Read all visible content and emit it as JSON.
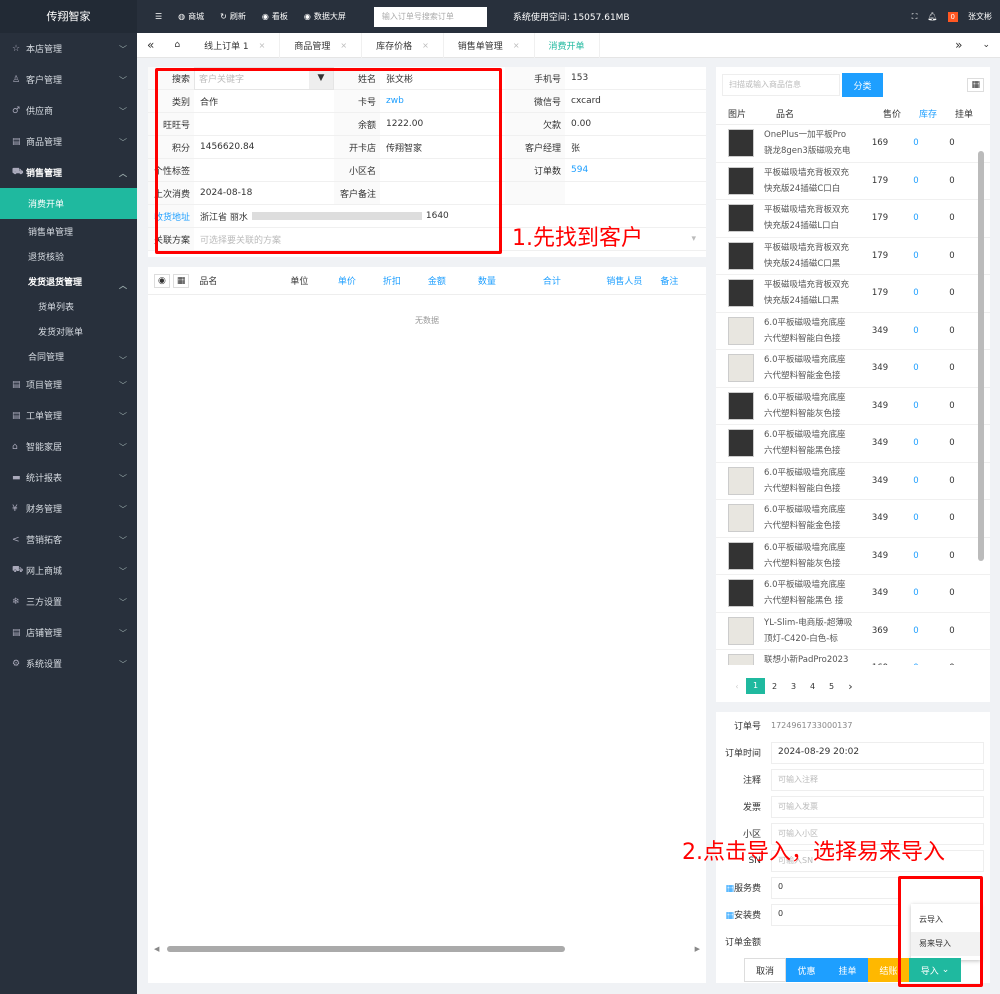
{
  "app": {
    "brand": "传翔智家"
  },
  "sidebar": {
    "items": [
      {
        "label": "本店管理",
        "icon": "☆"
      },
      {
        "label": "客户管理",
        "icon": "♙"
      },
      {
        "label": "供应商",
        "icon": "♂"
      },
      {
        "label": "商品管理",
        "icon": "▤"
      },
      {
        "label": "销售管理",
        "icon": "⛟"
      }
    ],
    "sales_sub": [
      "消费开单",
      "销售单管理",
      "退货核验",
      "发货退货管理"
    ],
    "ship_sub": [
      "货单列表",
      "发货对账单"
    ],
    "contract": "合同管理",
    "items2": [
      {
        "label": "项目管理",
        "icon": "▤"
      },
      {
        "label": "工单管理",
        "icon": "▤"
      },
      {
        "label": "智能家居",
        "icon": "⌂"
      },
      {
        "label": "统计报表",
        "icon": "▬"
      },
      {
        "label": "财务管理",
        "icon": "¥"
      },
      {
        "label": "营销拓客",
        "icon": "<"
      },
      {
        "label": "网上商城",
        "icon": "⛟"
      },
      {
        "label": "三方设置",
        "icon": "❄"
      },
      {
        "label": "店铺管理",
        "icon": "▤"
      },
      {
        "label": "系统设置",
        "icon": "⚙"
      }
    ]
  },
  "topbar": {
    "mall": "商城",
    "refresh": "刷新",
    "board": "看板",
    "bigscreen": "数据大屏",
    "search_placeholder": "输入订单号搜索订单",
    "space": "系统使用空间: 15057.61MB",
    "badge": "0",
    "user": "张文彬"
  },
  "tabs": [
    "线上订单 1",
    "商品管理",
    "库存价格",
    "销售单管理",
    "消费开单"
  ],
  "customer": {
    "search_label": "搜索",
    "search_placeholder": "客户关键字",
    "rows": [
      [
        "",
        "",
        "姓名",
        "张文彬",
        "手机号",
        "153"
      ],
      [
        "类别",
        "合作",
        "卡号",
        "zwb",
        "微信号",
        "cxcard"
      ],
      [
        "旺旺号",
        "",
        "余额",
        "1222.00",
        "欠款",
        "0.00"
      ],
      [
        "积分",
        "1456620.84",
        "开卡店",
        "传翔智家",
        "客户经理",
        "张"
      ],
      [
        "个性标签",
        "",
        "小区名",
        "",
        "订单数",
        "594"
      ],
      [
        "上次消费",
        "2024-08-18",
        "客户备注",
        "",
        "",
        ""
      ]
    ],
    "addr_label": "收货地址",
    "addr": "浙江省 丽水",
    "addr_tail": "1640",
    "plan_label": "关联方案",
    "plan_placeholder": "可选择要关联的方案"
  },
  "annotations": {
    "step1": "1.先找到客户",
    "step2": "2.点击导入，选择易来导入"
  },
  "order_table": {
    "headers": [
      "品名",
      "单位",
      "单价",
      "折扣",
      "金额",
      "数量",
      "合计",
      "销售人员",
      "备注"
    ],
    "empty": "无数据"
  },
  "products": {
    "search_placeholder": "扫描或输入商品信息",
    "category_btn": "分类",
    "headers": [
      "图片",
      "品名",
      "售价",
      "库存",
      "挂单"
    ],
    "rows": [
      {
        "name": "OnePlus一加平板Pro 骁龙8gen3版磁吸充电",
        "price": "169",
        "stock": "0",
        "hang": "0"
      },
      {
        "name": "平板磁吸墙充背板双充快充版24插磁C口白",
        "price": "179",
        "stock": "0",
        "hang": "0"
      },
      {
        "name": "平板磁吸墙充背板双充快充版24插磁L口白",
        "price": "179",
        "stock": "0",
        "hang": "0"
      },
      {
        "name": "平板磁吸墙充背板双充快充版24插磁C口黑",
        "price": "179",
        "stock": "0",
        "hang": "0"
      },
      {
        "name": "平板磁吸墙充背板双充快充版24插磁L口黑",
        "price": "179",
        "stock": "0",
        "hang": "0"
      },
      {
        "name": "6.0平板磁吸墙充底座 六代塑料智能白色接",
        "price": "349",
        "stock": "0",
        "hang": "0"
      },
      {
        "name": "6.0平板磁吸墙充底座 六代塑料智能金色接",
        "price": "349",
        "stock": "0",
        "hang": "0"
      },
      {
        "name": "6.0平板磁吸墙充底座 六代塑料智能灰色接",
        "price": "349",
        "stock": "0",
        "hang": "0"
      },
      {
        "name": "6.0平板磁吸墙充底座 六代塑料智能黑色接",
        "price": "349",
        "stock": "0",
        "hang": "0"
      },
      {
        "name": "6.0平板磁吸墙充底座 六代塑料智能白色接",
        "price": "349",
        "stock": "0",
        "hang": "0"
      },
      {
        "name": "6.0平板磁吸墙充底座 六代塑料智能金色接",
        "price": "349",
        "stock": "0",
        "hang": "0"
      },
      {
        "name": "6.0平板磁吸墙充底座 六代塑料智能灰色接",
        "price": "349",
        "stock": "0",
        "hang": "0"
      },
      {
        "name": "6.0平板磁吸墙充底座 六代塑料智能黑色 接",
        "price": "349",
        "stock": "0",
        "hang": "0"
      },
      {
        "name": "YL-Slim-电商版-超薄吸顶灯-C420-白色-标",
        "price": "369",
        "stock": "0",
        "hang": "0"
      },
      {
        "name": "联想小新PadPro2023",
        "price": "169",
        "stock": "0",
        "hang": "0"
      }
    ],
    "pages": [
      "1",
      "2",
      "3",
      "4",
      "5"
    ]
  },
  "order": {
    "no_label": "订单号",
    "no": "1724961733000137",
    "time_label": "订单时间",
    "time": "2024-08-29 20:02",
    "note_label": "注释",
    "note_ph": "可输入注释",
    "invoice_label": "发票",
    "invoice_ph": "可输入发票",
    "area_label": "小区",
    "area_ph": "可输入小区",
    "sn_label": "SN",
    "sn_ph": "可输入SN",
    "service_label": "服务费",
    "service": "0",
    "install_label": "安装费",
    "install": "0",
    "total_label": "订单金额",
    "dropdown": [
      "云导入",
      "易来导入"
    ],
    "buttons": {
      "cancel": "取消",
      "discount": "优惠",
      "hang": "挂单",
      "settle": "结账",
      "import": "导入"
    }
  }
}
